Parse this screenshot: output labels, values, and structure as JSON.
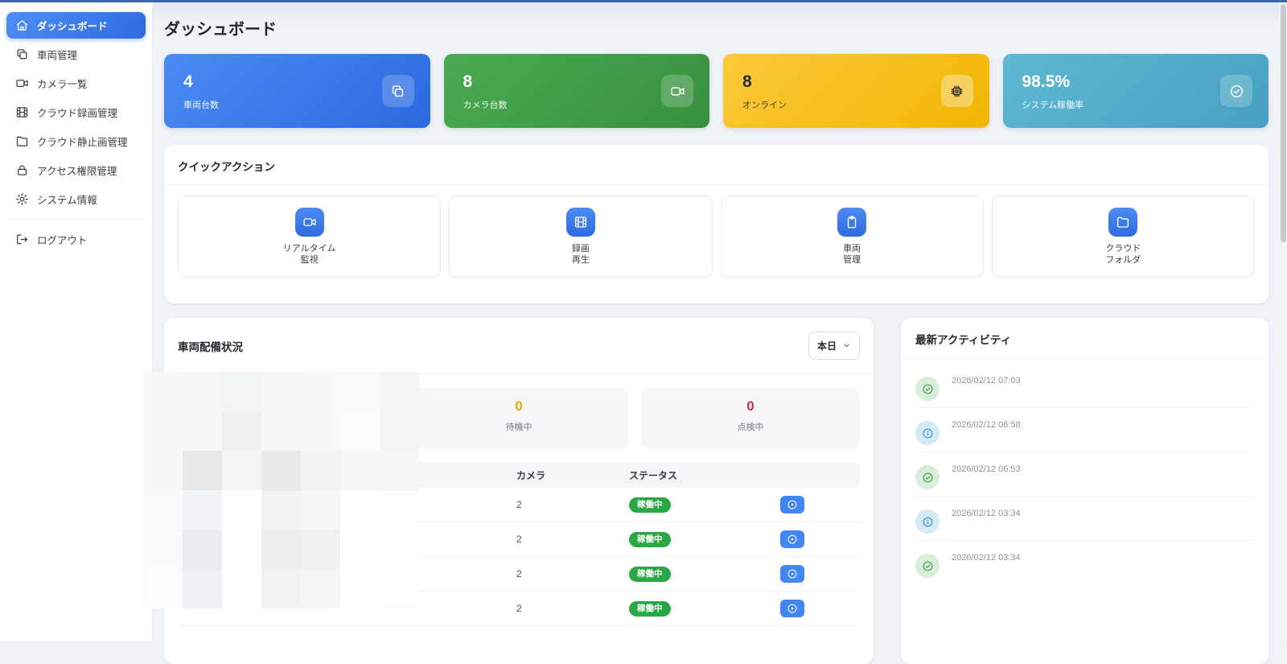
{
  "colors": {
    "topbar": "#3f66a8",
    "brand_blue": "#4285f4",
    "success_green": "#28a745",
    "warning_amber": "#eaa800",
    "danger_red": "#cf2f3e",
    "card_blue": "#2b6adf",
    "card_green": "#37903e",
    "card_yellow": "#f1b603",
    "card_teal": "#48a0c2"
  },
  "header": {
    "title": "ダッシュボード"
  },
  "sidebar": {
    "items": [
      {
        "name": "dashboard",
        "label": "ダッシュボード",
        "icon": "home-icon",
        "active": true
      },
      {
        "name": "vehicles",
        "label": "車両管理",
        "icon": "copy-icon"
      },
      {
        "name": "camera-list",
        "label": "カメラ一覧",
        "icon": "video-camera-icon"
      },
      {
        "name": "cloud-recordings",
        "label": "クラウド録画管理",
        "icon": "film-icon"
      },
      {
        "name": "cloud-stills",
        "label": "クラウド静止画管理",
        "icon": "folder-icon"
      },
      {
        "name": "access-control",
        "label": "アクセス権限管理",
        "icon": "lock-icon"
      },
      {
        "name": "system-info",
        "label": "システム情報",
        "icon": "gear-icon"
      }
    ],
    "logout": {
      "name": "logout",
      "label": "ログアウト",
      "icon": "logout-icon"
    }
  },
  "stat_cards": [
    {
      "name": "vehicle-count",
      "value": "4",
      "label": "車両台数",
      "icon": "copy-icon",
      "theme": "blue"
    },
    {
      "name": "camera-count",
      "value": "8",
      "label": "カメラ台数",
      "icon": "video-camera-icon",
      "theme": "green"
    },
    {
      "name": "online-count",
      "value": "8",
      "label": "オンライン",
      "icon": "chip-icon",
      "theme": "yellow"
    },
    {
      "name": "uptime",
      "value": "98.5%",
      "label": "システム稼働率",
      "icon": "check-circle-icon",
      "theme": "teal"
    }
  ],
  "quick_actions": {
    "title": "クイックアクション",
    "items": [
      {
        "name": "realtime-monitor",
        "line1": "リアルタイム",
        "line2": "監視",
        "icon": "video-camera-icon"
      },
      {
        "name": "recording-playback",
        "line1": "録画",
        "line2": "再生",
        "icon": "film-icon"
      },
      {
        "name": "vehicle-management",
        "line1": "車両",
        "line2": "管理",
        "icon": "clipboard-icon"
      },
      {
        "name": "cloud-folder",
        "line1": "クラウド",
        "line2": "フォルダ",
        "icon": "folder-icon"
      }
    ]
  },
  "deployment": {
    "title": "車両配備状況",
    "period_value": "本日",
    "stats": [
      {
        "name": "redacted",
        "value": "",
        "label": "",
        "theme": "hidden",
        "obscured": true
      },
      {
        "name": "standby",
        "value": "0",
        "label": "待機中",
        "theme": "amber"
      },
      {
        "name": "inspection",
        "value": "0",
        "label": "点検中",
        "theme": "red"
      }
    ],
    "table": {
      "headers": [
        "",
        "カメラ",
        "ステータス",
        ""
      ],
      "rows": [
        {
          "camera": "2",
          "status": "稼働中"
        },
        {
          "camera": "2",
          "status": "稼働中"
        },
        {
          "camera": "2",
          "status": "稼働中"
        },
        {
          "camera": "2",
          "status": "稼働中"
        }
      ]
    }
  },
  "activity": {
    "title": "最新アクティビティ",
    "items": [
      {
        "time": "2026/02/12 07:03",
        "type": "success",
        "icon": "check-circle-icon"
      },
      {
        "time": "2026/02/12 06:58",
        "type": "info",
        "icon": "info-icon"
      },
      {
        "time": "2026/02/12 06:53",
        "type": "success",
        "icon": "check-circle-icon"
      },
      {
        "time": "2026/02/12 03:34",
        "type": "info",
        "icon": "info-icon"
      },
      {
        "time": "2026/02/12 03:34",
        "type": "success",
        "icon": "check-circle-icon"
      }
    ]
  },
  "redaction": {
    "colors": [
      [
        "#f6f8f9",
        "#f5f7f9",
        "#f1f5f5",
        "#f5f7f8",
        "#f7f8fa",
        "#f9fafb",
        "#f3f5f7"
      ],
      [
        "#f6f8f9",
        "#f5f7f9",
        "#edf1f2",
        "#f4f6f7",
        "#f7f8f9",
        "#fafbfc",
        "#f3f5f7"
      ],
      [
        "#f7f8f9",
        "#e6e8ea",
        "#f4f5f7",
        "#e8eaec",
        "#f3f3f5",
        "#f6f7f8",
        "#f4f6f8"
      ],
      [
        "#f8fafb",
        "#f1f4f6",
        "#ffffff",
        "#f1f2f2",
        "#f7f7f7",
        "#ffffff",
        "#fcfdfd"
      ],
      [
        "#f8fafb",
        "#e9edf0",
        "#ffffff",
        "#edeeef",
        "#f0f0ef",
        "#ffffff",
        "#fcfdfd"
      ],
      [
        "#f9fbfc",
        "#eef2f4",
        "#ffffff",
        "#f1f2f1",
        "#f5f5f4",
        "#ffffff",
        "#fcfdfd"
      ]
    ]
  }
}
